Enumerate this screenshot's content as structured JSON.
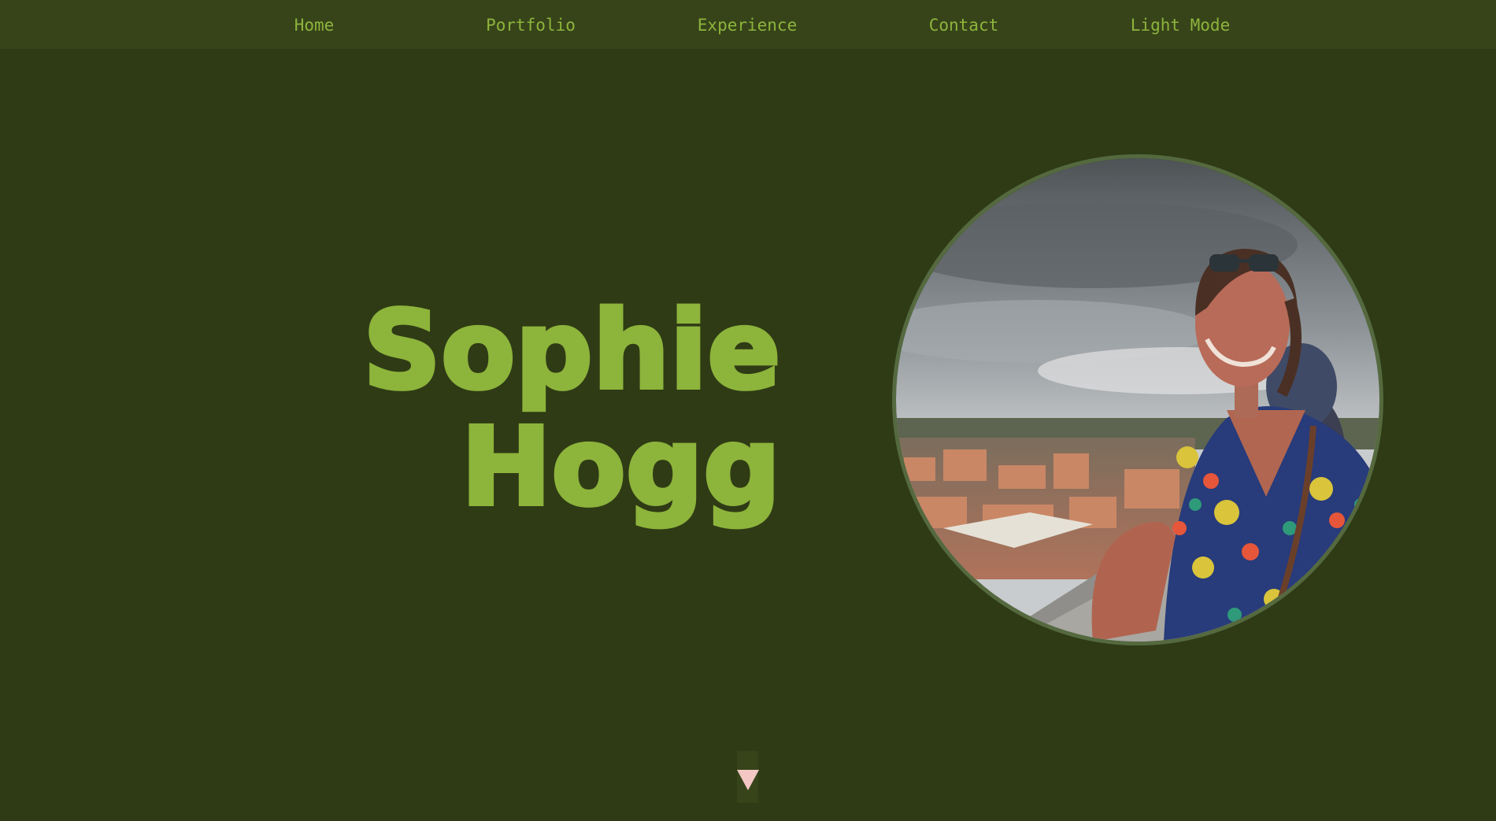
{
  "nav": {
    "items": [
      {
        "label": "Home"
      },
      {
        "label": "Portfolio"
      },
      {
        "label": "Experience"
      },
      {
        "label": "Contact"
      },
      {
        "label": "Light Mode"
      }
    ]
  },
  "hero": {
    "first_name": "Sophie",
    "last_name": "Hogg",
    "photo_alt": "Sophie Hogg"
  },
  "colors": {
    "background": "#2f3b15",
    "navbar": "#37441a",
    "accent": "#8db43b",
    "portrait_border": "#55693f",
    "arrow": "#f3c7c3"
  },
  "icons": {
    "scroll": "triangle-down-icon"
  }
}
